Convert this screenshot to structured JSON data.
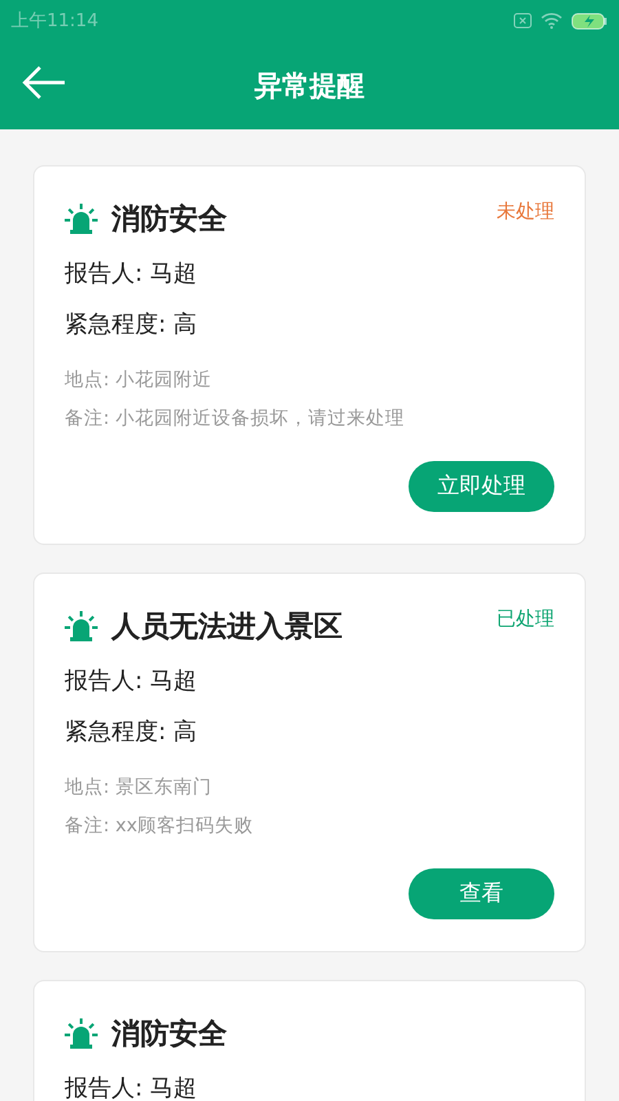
{
  "status_bar": {
    "time": "上午11:14"
  },
  "header": {
    "title": "异常提醒"
  },
  "alerts": [
    {
      "title": "消防安全",
      "status": {
        "text": "未处理",
        "kind": "pending"
      },
      "reporter": "报告人: 马超",
      "urgency": "紧急程度: 高",
      "location": "地点: 小花园附近",
      "note": "备注: 小花园附近设备损坏，请过来处理",
      "action": "立即处理"
    },
    {
      "title": "人员无法进入景区",
      "status": {
        "text": "已处理",
        "kind": "done"
      },
      "reporter": "报告人: 马超",
      "urgency": "紧急程度: 高",
      "location": "地点: 景区东南门",
      "note": "备注: xx顾客扫码失败",
      "action": "查看"
    },
    {
      "title": "消防安全",
      "reporter": "报告人: 马超"
    }
  ]
}
